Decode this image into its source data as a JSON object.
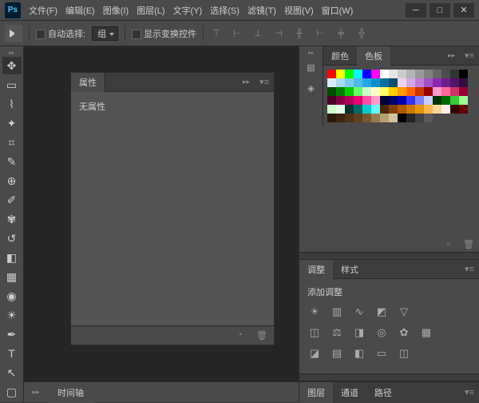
{
  "app": {
    "logo": "Ps"
  },
  "menu": [
    "文件(F)",
    "编辑(E)",
    "图像(I)",
    "图层(L)",
    "文字(Y)",
    "选择(S)",
    "滤镜(T)",
    "视图(V)",
    "窗口(W)"
  ],
  "optbar": {
    "autoselect_label": "自动选择:",
    "group_label": "组",
    "transform_label": "显示变换控件"
  },
  "tools": [
    "move",
    "marquee",
    "lasso",
    "wand",
    "crop",
    "eyedropper",
    "healing",
    "brush",
    "stamp",
    "history-brush",
    "eraser",
    "gradient",
    "blur",
    "dodge",
    "pen",
    "type",
    "path",
    "shape"
  ],
  "properties": {
    "tab": "属性",
    "empty": "无属性"
  },
  "timeline": {
    "tab": "时间轴"
  },
  "color_panel": {
    "tabs": [
      "颜色",
      "色板"
    ],
    "active": 1,
    "swatches": [
      [
        "#ff0000",
        "#ffff00",
        "#00ff00",
        "#00ffff",
        "#0000ff",
        "#ff00ff",
        "#ffffff",
        "#e6e6e6",
        "#cccccc",
        "#b3b3b3",
        "#999999",
        "#808080",
        "#666666",
        "#4d4d4d",
        "#333333",
        "#000000"
      ],
      [
        "#d4edfa",
        "#a8dbf5",
        "#7cc9f0",
        "#4fb8eb",
        "#23a6e6",
        "#0d8ecc",
        "#0a6e9e",
        "#074e70",
        "#e8d4f0",
        "#d1a8e0",
        "#ba7dd1",
        "#a351c2",
        "#8c26b3",
        "#6e1e8c",
        "#501666",
        "#320e40"
      ],
      [
        "#004d00",
        "#008000",
        "#00cc00",
        "#66ff66",
        "#ccffcc",
        "#ffffcc",
        "#ffff66",
        "#ffcc00",
        "#ff9900",
        "#ff6600",
        "#cc3300",
        "#990000",
        "#ff99cc",
        "#ff6699",
        "#cc3366",
        "#990033"
      ],
      [
        "#4d0026",
        "#800040",
        "#b30059",
        "#e60073",
        "#ff4da6",
        "#ff99cc",
        "#000033",
        "#000066",
        "#0000b3",
        "#3333ff",
        "#8080ff",
        "#ccccff",
        "#003300",
        "#006600",
        "#33cc33",
        "#99ff99"
      ],
      [
        "#ccffcc",
        "#e6ffe6",
        "#003333",
        "#006666",
        "#00cccc",
        "#66ffff",
        "#4d2600",
        "#804000",
        "#b35900",
        "#cc7a00",
        "#e69500",
        "#ffb84d",
        "#ffd699",
        "#fff0e6",
        "#330000",
        "#660000"
      ],
      [
        "#2b1a0a",
        "#3d2610",
        "#4f3217",
        "#614020",
        "#7a5633",
        "#997a52",
        "#b89e75",
        "#d6c299",
        "#000000",
        "#262626",
        "#404040",
        "#595959"
      ]
    ]
  },
  "adjustments": {
    "tabs": [
      "调整",
      "样式"
    ],
    "active": 0,
    "add_label": "添加调整"
  },
  "layers": {
    "tabs": [
      "图层",
      "通道",
      "路径"
    ],
    "active": 0
  }
}
